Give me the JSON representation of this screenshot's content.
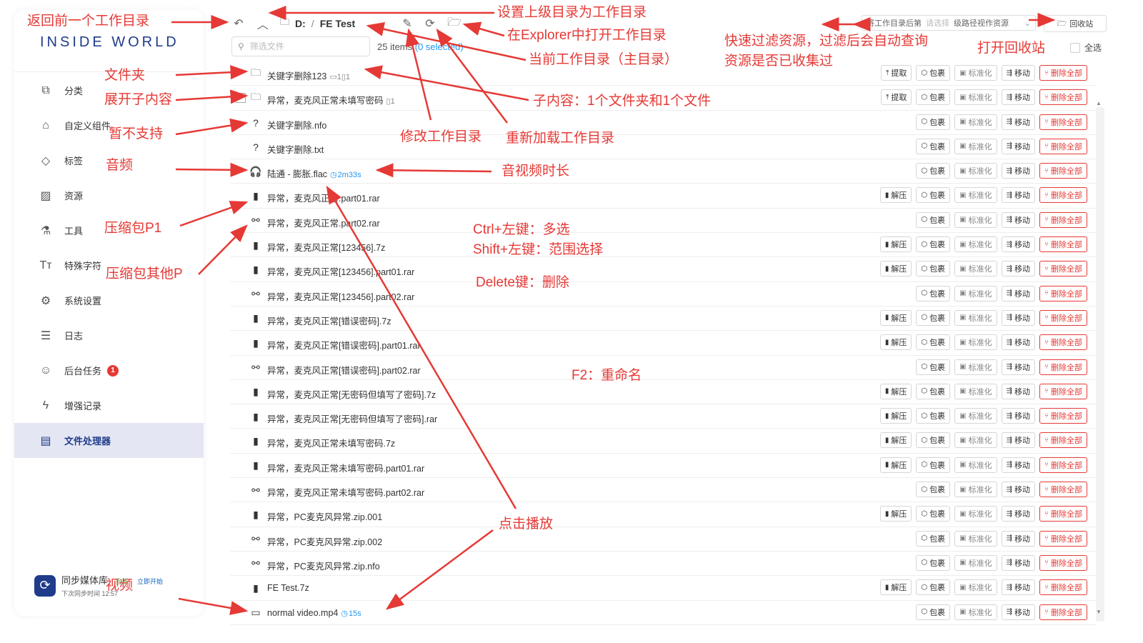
{
  "app": {
    "logo": "INSIDE WORLD"
  },
  "sidebar": {
    "items": [
      {
        "label": "分类",
        "icon": "category-icon"
      },
      {
        "label": "自定义组件",
        "icon": "component-icon"
      },
      {
        "label": "标签",
        "icon": "tag-icon"
      },
      {
        "label": "资源",
        "icon": "image-icon"
      },
      {
        "label": "工具",
        "icon": "flask-icon"
      },
      {
        "label": "特殊字符",
        "icon": "text-icon"
      },
      {
        "label": "系统设置",
        "icon": "gear-icon"
      },
      {
        "label": "日志",
        "icon": "log-icon"
      },
      {
        "label": "后台任务",
        "icon": "robot-icon",
        "badge": "1"
      },
      {
        "label": "增强记录",
        "icon": "lightning-icon"
      },
      {
        "label": "文件处理器",
        "icon": "file-processor-icon",
        "active": true
      }
    ],
    "sync": {
      "title": "同步媒体库",
      "status": "完成",
      "start": "立即开始",
      "subtitle": "下次同步时间 12:57"
    }
  },
  "toolbar": {
    "drive": "D:",
    "separator": "/",
    "folder": "FE Test",
    "filter_placeholder": "筛选文件",
    "count": "25 items",
    "selected": "(0 selected)",
    "wd_select_label": "将工作目录后第",
    "wd_select_placeholder": "请选择",
    "wd_select_suffix": "级路径视作资源",
    "recycle_label": "回收站",
    "select_all": "全选"
  },
  "actions": {
    "extract_folder": "提取",
    "pack": "包裹",
    "standardize": "标准化",
    "move": "移动",
    "delete_all": "删除全部",
    "decompress": "解压"
  },
  "files": [
    {
      "name": "关键字删除123",
      "type": "folder",
      "meta": "▭1▯1",
      "actions": [
        "extract",
        "pack",
        "std",
        "move",
        "del"
      ]
    },
    {
      "name": "异常，麦克风正常未填写密码",
      "type": "folder",
      "meta": "▯1",
      "expand": "+",
      "actions": [
        "extract",
        "pack",
        "std",
        "move",
        "del"
      ]
    },
    {
      "name": "关键字删除.nfo",
      "type": "unknown",
      "actions": [
        "pack",
        "std",
        "move",
        "del"
      ]
    },
    {
      "name": "关键字删除.txt",
      "type": "unknown",
      "actions": [
        "pack",
        "std",
        "move",
        "del"
      ]
    },
    {
      "name": "陆通 - 膨胀.flac",
      "type": "audio",
      "duration": "2m33s",
      "actions": [
        "pack",
        "std",
        "move",
        "del"
      ]
    },
    {
      "name": "异常，麦克风正常.part01.rar",
      "type": "archive",
      "actions": [
        "unzip",
        "pack",
        "std",
        "move",
        "del"
      ]
    },
    {
      "name": "异常，麦克风正常.part02.rar",
      "type": "part",
      "actions": [
        "pack",
        "std",
        "move",
        "del"
      ]
    },
    {
      "name": "异常，麦克风正常[123456].7z",
      "type": "archive",
      "actions": [
        "unzip",
        "pack",
        "std",
        "move",
        "del"
      ]
    },
    {
      "name": "异常，麦克风正常[123456].part01.rar",
      "type": "archive",
      "actions": [
        "unzip",
        "pack",
        "std",
        "move",
        "del"
      ]
    },
    {
      "name": "异常，麦克风正常[123456].part02.rar",
      "type": "part",
      "actions": [
        "pack",
        "std",
        "move",
        "del"
      ]
    },
    {
      "name": "异常，麦克风正常[错误密码].7z",
      "type": "archive",
      "actions": [
        "unzip",
        "pack",
        "std",
        "move",
        "del"
      ]
    },
    {
      "name": "异常，麦克风正常[错误密码].part01.rar",
      "type": "archive",
      "actions": [
        "unzip",
        "pack",
        "std",
        "move",
        "del"
      ]
    },
    {
      "name": "异常，麦克风正常[错误密码].part02.rar",
      "type": "part",
      "actions": [
        "pack",
        "std",
        "move",
        "del"
      ]
    },
    {
      "name": "异常，麦克风正常[无密码但填写了密码].7z",
      "type": "archive",
      "actions": [
        "unzip",
        "pack",
        "std",
        "move",
        "del"
      ]
    },
    {
      "name": "异常，麦克风正常[无密码但填写了密码].rar",
      "type": "archive",
      "actions": [
        "unzip",
        "pack",
        "std",
        "move",
        "del"
      ]
    },
    {
      "name": "异常，麦克风正常未填写密码.7z",
      "type": "archive",
      "actions": [
        "unzip",
        "pack",
        "std",
        "move",
        "del"
      ]
    },
    {
      "name": "异常，麦克风正常未填写密码.part01.rar",
      "type": "archive",
      "actions": [
        "unzip",
        "pack",
        "std",
        "move",
        "del"
      ]
    },
    {
      "name": "异常，麦克风正常未填写密码.part02.rar",
      "type": "part",
      "actions": [
        "pack",
        "std",
        "move",
        "del"
      ]
    },
    {
      "name": "异常，PC麦克风异常.zip.001",
      "type": "archive",
      "actions": [
        "unzip",
        "pack",
        "std",
        "move",
        "del"
      ]
    },
    {
      "name": "异常，PC麦克风异常.zip.002",
      "type": "part",
      "actions": [
        "pack",
        "std",
        "move",
        "del"
      ]
    },
    {
      "name": "异常，PC麦克风异常.zip.nfo",
      "type": "part",
      "actions": [
        "pack",
        "std",
        "move",
        "del"
      ]
    },
    {
      "name": "FE Test.7z",
      "type": "archive",
      "actions": [
        "unzip",
        "pack",
        "std",
        "move",
        "del"
      ]
    },
    {
      "name": "normal video.mp4",
      "type": "video",
      "duration": "15s",
      "actions": [
        "pack",
        "std",
        "move",
        "del"
      ]
    }
  ],
  "annotations": {
    "back": "返回前一个工作目录",
    "set_parent": "设置上级目录为工作目录",
    "open_explorer": "在Explorer中打开工作目录",
    "current_dir": "当前工作目录（主目录）",
    "quick_filter_1": "快速过滤资源，过滤后会自动查询",
    "quick_filter_2": "资源是否已收集过",
    "open_recycle": "打开回收站",
    "folder": "文件夹",
    "expand": "展开子内容",
    "children": "子内容：1个文件夹和1个文件",
    "unsupported": "暂不支持",
    "modify_wd": "修改工作目录",
    "reload_wd": "重新加载工作目录",
    "audio": "音频",
    "duration": "音视频时长",
    "archive_p1": "压缩包P1",
    "archive_other": "压缩包其他P",
    "ctrl": "Ctrl+左键：多选",
    "shift": "Shift+左键：范围选择",
    "delete": "Delete键：删除",
    "f2": "F2：重命名",
    "click_play": "点击播放",
    "video": "视频"
  },
  "colors": {
    "accent": "#1f3b8a",
    "annotation": "#e53935",
    "danger": "#e53935",
    "link": "#2196f3"
  }
}
